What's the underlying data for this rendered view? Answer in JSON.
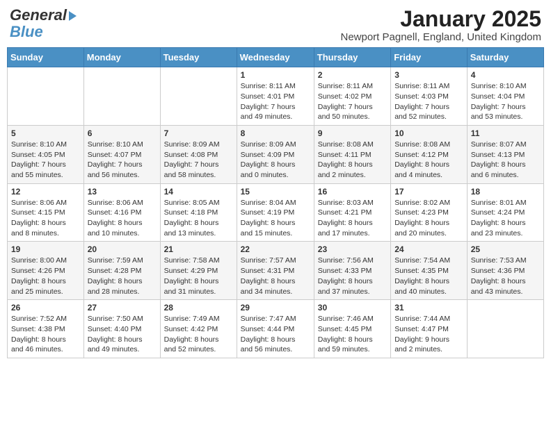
{
  "header": {
    "logo_general": "General",
    "logo_blue": "Blue",
    "month_title": "January 2025",
    "location": "Newport Pagnell, England, United Kingdom"
  },
  "columns": [
    "Sunday",
    "Monday",
    "Tuesday",
    "Wednesday",
    "Thursday",
    "Friday",
    "Saturday"
  ],
  "weeks": [
    [
      {
        "day": "",
        "content": ""
      },
      {
        "day": "",
        "content": ""
      },
      {
        "day": "",
        "content": ""
      },
      {
        "day": "1",
        "content": "Sunrise: 8:11 AM\nSunset: 4:01 PM\nDaylight: 7 hours\nand 49 minutes."
      },
      {
        "day": "2",
        "content": "Sunrise: 8:11 AM\nSunset: 4:02 PM\nDaylight: 7 hours\nand 50 minutes."
      },
      {
        "day": "3",
        "content": "Sunrise: 8:11 AM\nSunset: 4:03 PM\nDaylight: 7 hours\nand 52 minutes."
      },
      {
        "day": "4",
        "content": "Sunrise: 8:10 AM\nSunset: 4:04 PM\nDaylight: 7 hours\nand 53 minutes."
      }
    ],
    [
      {
        "day": "5",
        "content": "Sunrise: 8:10 AM\nSunset: 4:05 PM\nDaylight: 7 hours\nand 55 minutes."
      },
      {
        "day": "6",
        "content": "Sunrise: 8:10 AM\nSunset: 4:07 PM\nDaylight: 7 hours\nand 56 minutes."
      },
      {
        "day": "7",
        "content": "Sunrise: 8:09 AM\nSunset: 4:08 PM\nDaylight: 7 hours\nand 58 minutes."
      },
      {
        "day": "8",
        "content": "Sunrise: 8:09 AM\nSunset: 4:09 PM\nDaylight: 8 hours\nand 0 minutes."
      },
      {
        "day": "9",
        "content": "Sunrise: 8:08 AM\nSunset: 4:11 PM\nDaylight: 8 hours\nand 2 minutes."
      },
      {
        "day": "10",
        "content": "Sunrise: 8:08 AM\nSunset: 4:12 PM\nDaylight: 8 hours\nand 4 minutes."
      },
      {
        "day": "11",
        "content": "Sunrise: 8:07 AM\nSunset: 4:13 PM\nDaylight: 8 hours\nand 6 minutes."
      }
    ],
    [
      {
        "day": "12",
        "content": "Sunrise: 8:06 AM\nSunset: 4:15 PM\nDaylight: 8 hours\nand 8 minutes."
      },
      {
        "day": "13",
        "content": "Sunrise: 8:06 AM\nSunset: 4:16 PM\nDaylight: 8 hours\nand 10 minutes."
      },
      {
        "day": "14",
        "content": "Sunrise: 8:05 AM\nSunset: 4:18 PM\nDaylight: 8 hours\nand 13 minutes."
      },
      {
        "day": "15",
        "content": "Sunrise: 8:04 AM\nSunset: 4:19 PM\nDaylight: 8 hours\nand 15 minutes."
      },
      {
        "day": "16",
        "content": "Sunrise: 8:03 AM\nSunset: 4:21 PM\nDaylight: 8 hours\nand 17 minutes."
      },
      {
        "day": "17",
        "content": "Sunrise: 8:02 AM\nSunset: 4:23 PM\nDaylight: 8 hours\nand 20 minutes."
      },
      {
        "day": "18",
        "content": "Sunrise: 8:01 AM\nSunset: 4:24 PM\nDaylight: 8 hours\nand 23 minutes."
      }
    ],
    [
      {
        "day": "19",
        "content": "Sunrise: 8:00 AM\nSunset: 4:26 PM\nDaylight: 8 hours\nand 25 minutes."
      },
      {
        "day": "20",
        "content": "Sunrise: 7:59 AM\nSunset: 4:28 PM\nDaylight: 8 hours\nand 28 minutes."
      },
      {
        "day": "21",
        "content": "Sunrise: 7:58 AM\nSunset: 4:29 PM\nDaylight: 8 hours\nand 31 minutes."
      },
      {
        "day": "22",
        "content": "Sunrise: 7:57 AM\nSunset: 4:31 PM\nDaylight: 8 hours\nand 34 minutes."
      },
      {
        "day": "23",
        "content": "Sunrise: 7:56 AM\nSunset: 4:33 PM\nDaylight: 8 hours\nand 37 minutes."
      },
      {
        "day": "24",
        "content": "Sunrise: 7:54 AM\nSunset: 4:35 PM\nDaylight: 8 hours\nand 40 minutes."
      },
      {
        "day": "25",
        "content": "Sunrise: 7:53 AM\nSunset: 4:36 PM\nDaylight: 8 hours\nand 43 minutes."
      }
    ],
    [
      {
        "day": "26",
        "content": "Sunrise: 7:52 AM\nSunset: 4:38 PM\nDaylight: 8 hours\nand 46 minutes."
      },
      {
        "day": "27",
        "content": "Sunrise: 7:50 AM\nSunset: 4:40 PM\nDaylight: 8 hours\nand 49 minutes."
      },
      {
        "day": "28",
        "content": "Sunrise: 7:49 AM\nSunset: 4:42 PM\nDaylight: 8 hours\nand 52 minutes."
      },
      {
        "day": "29",
        "content": "Sunrise: 7:47 AM\nSunset: 4:44 PM\nDaylight: 8 hours\nand 56 minutes."
      },
      {
        "day": "30",
        "content": "Sunrise: 7:46 AM\nSunset: 4:45 PM\nDaylight: 8 hours\nand 59 minutes."
      },
      {
        "day": "31",
        "content": "Sunrise: 7:44 AM\nSunset: 4:47 PM\nDaylight: 9 hours\nand 2 minutes."
      },
      {
        "day": "",
        "content": ""
      }
    ]
  ]
}
